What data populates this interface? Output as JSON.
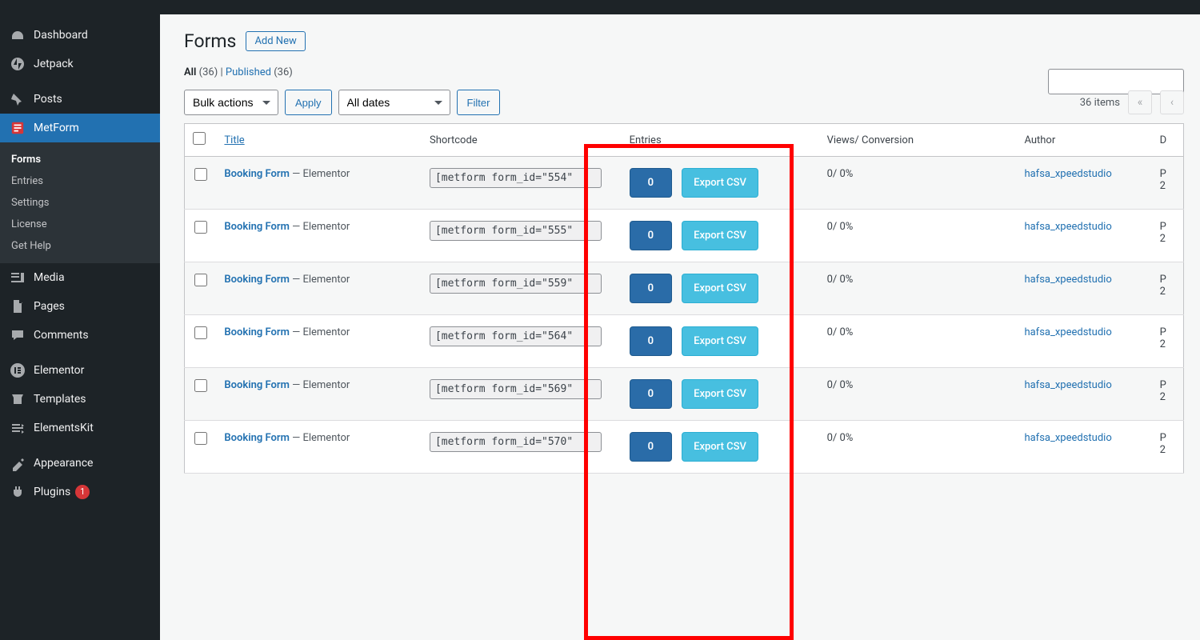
{
  "sidebar": {
    "items": [
      {
        "label": "Dashboard",
        "icon": "dashboard"
      },
      {
        "label": "Jetpack",
        "icon": "jetpack"
      },
      {
        "label": "Posts",
        "icon": "pin"
      },
      {
        "label": "MetForm",
        "icon": "metform",
        "active": true
      },
      {
        "label": "Media",
        "icon": "media"
      },
      {
        "label": "Pages",
        "icon": "pages"
      },
      {
        "label": "Comments",
        "icon": "comments"
      },
      {
        "label": "Elementor",
        "icon": "elementor"
      },
      {
        "label": "Templates",
        "icon": "templates"
      },
      {
        "label": "ElementsKit",
        "icon": "elementskit"
      },
      {
        "label": "Appearance",
        "icon": "appearance"
      },
      {
        "label": "Plugins",
        "icon": "plugins",
        "badge": "1"
      }
    ],
    "submenu": [
      "Forms",
      "Entries",
      "Settings",
      "License",
      "Get Help"
    ],
    "submenu_current": "Forms"
  },
  "header": {
    "title": "Forms",
    "add_new": "Add New"
  },
  "subsubsub": {
    "all_label": "All",
    "all_count": "(36)",
    "sep": " | ",
    "pub_label": "Published",
    "pub_count": "(36)"
  },
  "filters": {
    "bulk_label": "Bulk actions",
    "apply": "Apply",
    "dates": "All dates",
    "filter": "Filter"
  },
  "pagination": {
    "items_text": "36 items"
  },
  "columns": {
    "title": "Title",
    "shortcode": "Shortcode",
    "entries": "Entries",
    "views": "Views/ Conversion",
    "author": "Author",
    "date": "D"
  },
  "row_builder": "Elementor",
  "row_entries_label": "0",
  "row_export_label": "Export CSV",
  "rows": [
    {
      "title": "Booking Form",
      "shortcode": "[metform form_id=\"554\"",
      "views": "0/ 0%",
      "author": "hafsa_xpeedstudio",
      "date": "P\n2"
    },
    {
      "title": "Booking Form",
      "shortcode": "[metform form_id=\"555\"",
      "views": "0/ 0%",
      "author": "hafsa_xpeedstudio",
      "date": "P\n2"
    },
    {
      "title": "Booking Form",
      "shortcode": "[metform form_id=\"559\"",
      "views": "0/ 0%",
      "author": "hafsa_xpeedstudio",
      "date": "P\n2"
    },
    {
      "title": "Booking Form",
      "shortcode": "[metform form_id=\"564\"",
      "views": "0/ 0%",
      "author": "hafsa_xpeedstudio",
      "date": "P\n2"
    },
    {
      "title": "Booking Form",
      "shortcode": "[metform form_id=\"569\"",
      "views": "0/ 0%",
      "author": "hafsa_xpeedstudio",
      "date": "P\n2"
    },
    {
      "title": "Booking Form",
      "shortcode": "[metform form_id=\"570\"",
      "views": "0/ 0%",
      "author": "hafsa_xpeedstudio",
      "date": "P\n2"
    }
  ]
}
